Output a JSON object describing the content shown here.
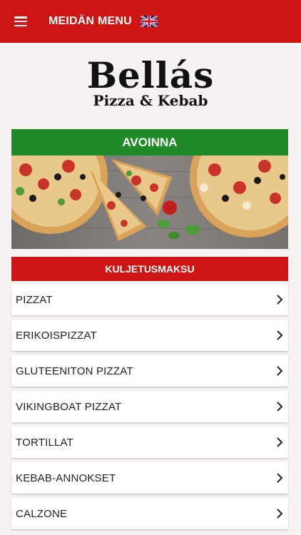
{
  "header": {
    "title": "MEIDÄN MENU",
    "menu_icon": "hamburger-icon",
    "language_icon": "uk-flag-icon"
  },
  "logo": {
    "name": "Bellás",
    "subtitle": "Pizza & Kebab"
  },
  "status": {
    "label": "AVOINNA",
    "color": "#1e8b27"
  },
  "delivery": {
    "label": "KULJETUSMAKSU",
    "color": "#cf1414"
  },
  "menu": {
    "items": [
      {
        "label": "PIZZAT"
      },
      {
        "label": "ERIKOISPIZZAT"
      },
      {
        "label": "GLUTEENITON PIZZAT"
      },
      {
        "label": "VIKINGBOAT PIZZAT"
      },
      {
        "label": "TORTILLAT"
      },
      {
        "label": "KEBAB-ANNOKSET"
      },
      {
        "label": "CALZONE"
      }
    ],
    "chevron_icon": "chevron-right-icon"
  },
  "colors": {
    "brand_red": "#cf1414",
    "background": "#f7f2f2"
  }
}
